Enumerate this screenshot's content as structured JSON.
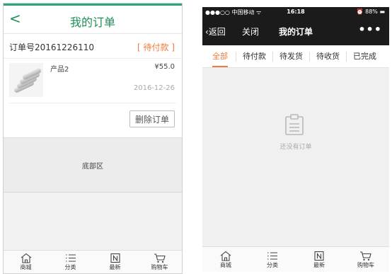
{
  "left": {
    "header": {
      "back": "<",
      "title": "我的订单"
    },
    "order": {
      "number": "订单号20161226110",
      "status": "[ 待付款 ]",
      "product_name": "产品2",
      "price": "¥55.0",
      "date": "2016-12-26",
      "delete_label": "删除订单"
    },
    "footer_label": "底部区",
    "tabbar": [
      {
        "label": "商城",
        "icon": "home-icon"
      },
      {
        "label": "分类",
        "icon": "list-icon"
      },
      {
        "label": "最新",
        "icon": "new-icon"
      },
      {
        "label": "购物车",
        "icon": "cart-icon"
      }
    ]
  },
  "right": {
    "status_bar": {
      "carrier": "●●●○○ 中国移动 ᯤ",
      "time": "16:18",
      "battery": "⏰ 88% ▬"
    },
    "nav": {
      "back": "‹返回",
      "close": "关闭",
      "title": "我的订单",
      "more": "•••"
    },
    "tabs": [
      "全部",
      "待付款",
      "待发货",
      "待收货",
      "已完成"
    ],
    "empty_text": "还没有订单",
    "tabbar": [
      {
        "label": "商城",
        "icon": "home-icon"
      },
      {
        "label": "分类",
        "icon": "list-icon"
      },
      {
        "label": "最新",
        "icon": "new-icon"
      },
      {
        "label": "购物车",
        "icon": "cart-icon"
      }
    ]
  },
  "colors": {
    "accent_green": "#1f8f5a",
    "status_orange": "#f07b3f",
    "dark_bar": "#1b1b1b"
  }
}
